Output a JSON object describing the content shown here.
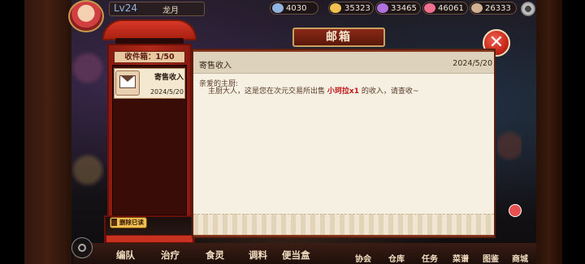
{
  "topbar": {
    "level": "Lv24",
    "player_name": "龙月",
    "resources": [
      {
        "icon": "blue-gem-icon",
        "value": "4030",
        "color": "#8fb4e0"
      },
      {
        "icon": "gold-coin-icon",
        "value": "35323",
        "color": "#f0c050"
      },
      {
        "icon": "purple-crystal-icon",
        "value": "33465",
        "color": "#b070e0"
      },
      {
        "icon": "pink-ticket-icon",
        "value": "46061",
        "color": "#f07090"
      },
      {
        "icon": "feather-icon",
        "value": "26333",
        "color": "#d0b090"
      }
    ]
  },
  "mailbox": {
    "title": "邮箱",
    "inbox_count": "收件箱：1/50",
    "delete_read_label": "删除已读",
    "items": [
      {
        "title": "寄售收入",
        "date": "2024/5/20"
      }
    ]
  },
  "message": {
    "title": "寄售收入",
    "date": "2024/5/20",
    "greeting": "亲爱的主厨:",
    "body_before": "主厨大人，这是您在次元交易所出售",
    "item_name": "小珂拉x1",
    "body_after": "的收入，请查收~"
  },
  "bottom_nav": [
    "编队",
    "治疗",
    "食灵",
    "调料",
    "便当盒",
    "协会",
    "仓库",
    "任务",
    "菜谱",
    "图鉴",
    "商城"
  ],
  "colors": {
    "accent_red": "#c01818",
    "banner": "#8a2818",
    "paper": "#f6f0e2"
  }
}
